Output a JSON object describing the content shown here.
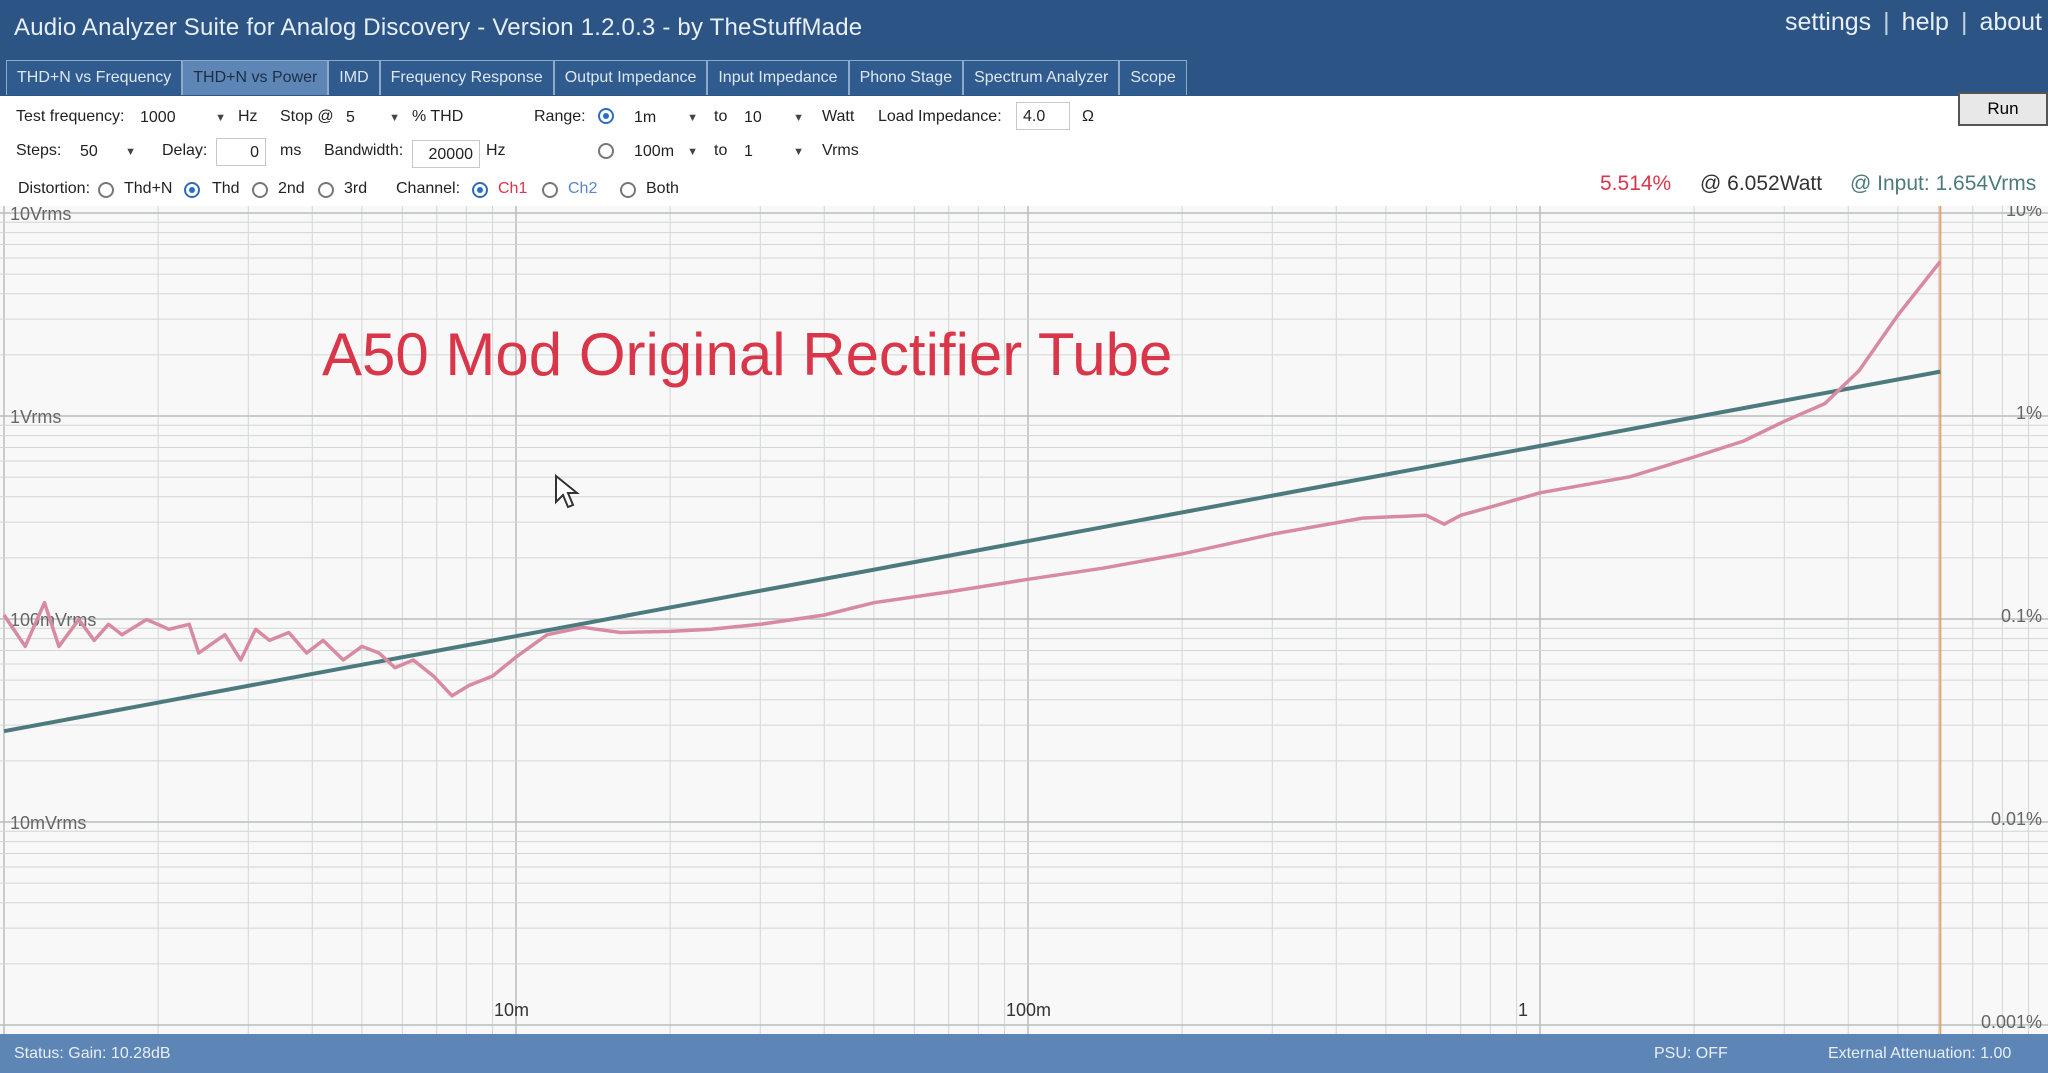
{
  "window": {
    "title": "Audio Analyzer Suite for Analog Discovery - Version   1.2.0.3   - by TheStuffMade",
    "links": [
      "settings",
      "help",
      "about"
    ]
  },
  "tabs": [
    {
      "label": "THD+N vs Frequency",
      "active": false
    },
    {
      "label": "THD+N vs Power",
      "active": true
    },
    {
      "label": "IMD",
      "active": false
    },
    {
      "label": "Frequency Response",
      "active": false
    },
    {
      "label": "Output Impedance",
      "active": false
    },
    {
      "label": "Input Impedance",
      "active": false
    },
    {
      "label": "Phono Stage",
      "active": false
    },
    {
      "label": "Spectrum Analyzer",
      "active": false
    },
    {
      "label": "Scope",
      "active": false
    }
  ],
  "controls": {
    "test_frequency_label": "Test frequency:",
    "test_frequency_value": "1000",
    "hz_unit": "Hz",
    "stop_label": "Stop @",
    "stop_value": "5",
    "thd_unit": "% THD",
    "range_label": "Range:",
    "range_watt_from": "1m",
    "range_watt_to": "10",
    "to_label": "to",
    "watt_unit": "Watt",
    "load_impedance_label": "Load Impedance:",
    "load_impedance_value": "4.0",
    "ohm_unit": "Ω",
    "range_vrms_from": "100m",
    "range_vrms_to": "1",
    "vrms_unit": "Vrms",
    "steps_label": "Steps:",
    "steps_value": "50",
    "delay_label": "Delay:",
    "delay_value": "0",
    "ms_unit": "ms",
    "bandwidth_label": "Bandwidth:",
    "bandwidth_value": "20000",
    "distortion_label": "Distortion:",
    "distortion_options": [
      "Thd+N",
      "Thd",
      "2nd",
      "3rd"
    ],
    "distortion_selected": "Thd",
    "channel_label": "Channel:",
    "channel_options": [
      "Ch1",
      "Ch2",
      "Both"
    ],
    "channel_selected": "Ch1",
    "run_label": "Run"
  },
  "readout": {
    "thd": "5.514%",
    "power": "@ 6.052Watt",
    "input": "@ Input: 1.654Vrms"
  },
  "overlay_text": "A50  Mod  Original Rectifier Tube",
  "chart_data": {
    "type": "line",
    "x_scale": "log",
    "x_unit": "Watt",
    "xlim": [
      0.001,
      6.052
    ],
    "x_ticks": [
      "10m",
      "100m",
      "1"
    ],
    "y_left_scale": "log",
    "y_left_ticks": [
      "10Vrms",
      "1Vrms",
      "100mVrms",
      "10mVrms"
    ],
    "y_right_scale": "log",
    "y_right_ticks": [
      "10%",
      "1%",
      "0.1%",
      "0.01%",
      "0.001%"
    ],
    "grid": true,
    "series": [
      {
        "axis": "left",
        "color": "#4d7a7e",
        "x": [
          0.001,
          6.052
        ],
        "y": [
          0.028,
          1.654
        ]
      },
      {
        "axis": "right",
        "color": "#d98aa3",
        "x": [
          0.001,
          0.0011,
          0.0012,
          0.00128,
          0.0014,
          0.0015,
          0.0016,
          0.0017,
          0.0019,
          0.0021,
          0.0023,
          0.0024,
          0.0027,
          0.0029,
          0.0031,
          0.0033,
          0.0036,
          0.0039,
          0.0042,
          0.0046,
          0.005,
          0.0054,
          0.0058,
          0.0063,
          0.0069,
          0.0075,
          0.0081,
          0.009,
          0.01,
          0.0115,
          0.0135,
          0.016,
          0.02,
          0.024,
          0.03,
          0.04,
          0.05,
          0.07,
          0.1,
          0.14,
          0.2,
          0.3,
          0.45,
          0.6,
          0.65,
          0.7,
          0.8,
          1.0,
          1.5,
          2.0,
          2.5,
          3.0,
          3.6,
          4.2,
          5.0,
          6.052
        ],
        "y": [
          0.1,
          0.07,
          0.115,
          0.07,
          0.095,
          0.075,
          0.09,
          0.08,
          0.095,
          0.085,
          0.09,
          0.065,
          0.08,
          0.06,
          0.085,
          0.075,
          0.082,
          0.065,
          0.075,
          0.06,
          0.07,
          0.065,
          0.055,
          0.06,
          0.05,
          0.04,
          0.045,
          0.05,
          0.062,
          0.08,
          0.087,
          0.082,
          0.083,
          0.085,
          0.09,
          0.1,
          0.115,
          0.13,
          0.15,
          0.17,
          0.2,
          0.25,
          0.3,
          0.31,
          0.28,
          0.31,
          0.34,
          0.4,
          0.48,
          0.6,
          0.72,
          0.9,
          1.1,
          1.6,
          3.0,
          5.514
        ]
      }
    ]
  },
  "status": {
    "left": "Status: Gain: 10.28dB",
    "psu": "PSU: OFF",
    "right": "External Attenuation: 1.00"
  }
}
